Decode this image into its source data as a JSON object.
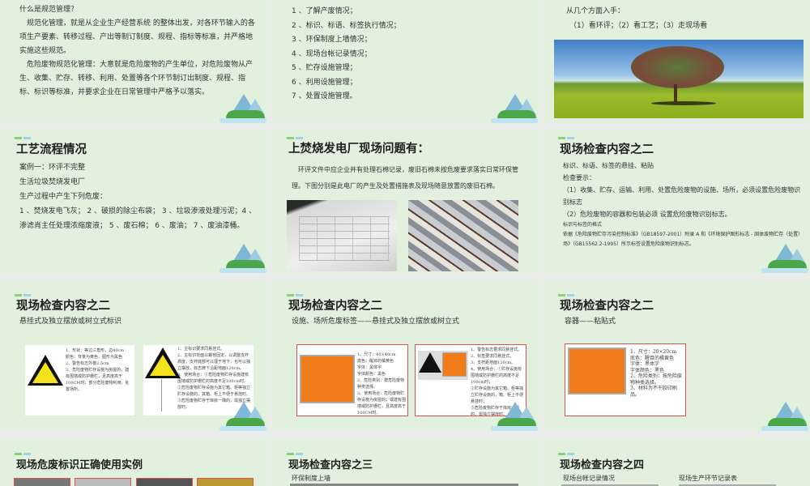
{
  "slides": [
    {
      "lines": [
        "什么是规范管理？",
        "　规范化管理，就是从企业生产经营系统 的整体出发，对各环节输入的各项生产要素、转移过程、产出等制订制度、规程、指标等标准，并严格地实施这些规范。",
        "　危险废物规范化管理：大意就是危险废物的产生单位，对危险废物从产生、收集、贮存、转移、利用、处置等各个环节制订出制度、规程、指标、标识等标准，并要求企业在日常管理中严格予以落实。"
      ]
    },
    {
      "lines": [
        "1 、了解产废情况；",
        "2 、标识、标语、标签执行情况；",
        "3 、环保制度上墙情况；",
        "4 、现场台帐记录情况；",
        "5 、贮存设施管理；",
        "6 、利用设施管理；",
        "7 、处置设施管理。"
      ]
    },
    {
      "lines": [
        "从几个方面入手：",
        "（1）看环评；（2）看工艺；（3）走现场看"
      ]
    },
    {
      "title": "工艺流程情况",
      "lines": [
        "案例一：环评不完整",
        "生活垃圾焚烧发电厂",
        "生产过程中产生下列危废：",
        "1 、焚烧发电飞灰； 2 、破损的除尘布袋； 3 、垃圾渗液处理污泥；4 、渗滤肖主任处理浓缩废液； 5 、废石棉； 6 、废油； 7 、废油漆桶。"
      ]
    },
    {
      "title": "上焚烧发电厂现场问题有：",
      "lines": [
        "　环评文件中应企业并有处理石棉记录，废旧石棉未按危废要求落实日常环保管理。下图分别是此电厂的产生及处置措施表及现场随意放置的废旧石棉。"
      ]
    },
    {
      "title": "现场检查内容之二",
      "lines": [
        "标识、标语、标签的悬挂、粘贴",
        "检查要示：",
        "（1）收集、贮存、运输、利用、处置危险废物的设施、场所，必须设置危险废物识别标志",
        "（2）危险废物的容器和包装必须 设置危险废物识别标志。"
      ],
      "small": [
        "标识与标签的格式",
        "依据《危险废物贮存污染控制标准》（GB18597-2001）附录 A 和《环境保护图形标志 - 固体废物贮存（处置）场》（GB15562.2-1995）所示标签设置危险废物识别标志。"
      ]
    },
    {
      "title": "现场检查内容之二",
      "subtitle": "悬挂式及独立摆放或树立式标识",
      "notes1": [
        "1、形状：等边三角形，边40cm",
        "颜色：背景为黄色，图形为黑色",
        "2、警告标志外檐2.5cm",
        "3、危险废物贮存设施为房屋的，建有围墙或防护栅栏，且高度高于100CM时；部分危险废物利用、处置场所。"
      ],
      "notes2": [
        "1、主标识要求同悬挂式。",
        "2、主标识背面以螺栓固定，以调整支杆高度，支杆底部可以埋于地下，也可以独立摆放，标志牌下沿距地面120cm。",
        "3、使用场合：①危险废物贮存设施建有围墙或防护栅栏的高度不足100cm时。",
        "②危险废物贮存设施为其它箱、柜等独立贮存设施的，其箱、柜上不便于悬挂时。",
        "③危险废物贮存于库房一隅的，需独立摆放时。"
      ]
    },
    {
      "title": "现场检查内容之二",
      "subtitle": "设施、场所危废标签——悬挂式及独立摆放或树立式",
      "notes1": [
        "1、尺寸：40×40cm",
        "底色：醒目的橘黄色",
        "字体：黑体字",
        "字体颜色：黑色",
        "2、危险类别：按危险废物种类选择。",
        "3、使用场合：危险废物贮存设施为房屋的；或建有围墙或防护栅栏，且高度高于100CM时。"
      ],
      "notes2": [
        "1、警告标志要求同悬挂式。",
        "2、标签要求同悬挂式。",
        "3、支杆距地面120cm。",
        "4、使用场合：①贮存设施有围墙或防护栅栏的高度不足100cm时；",
        "②贮存设施为其它箱、柜等独立贮存设施的，箱、柜上不便悬挂时；",
        "③危险废物贮存于库房一隅的，需独立摆放时。"
      ]
    },
    {
      "title": "现场检查内容之二",
      "subtitle": "容器——粘贴式",
      "notes1": [
        "1、尺寸：20×20cm",
        "底色：醒目的橘黄色",
        "字体：黑体字",
        "字体颜色：黑色",
        "2、危险类别：按危险废物种类选择。",
        "3、材料为不干胶印刷品。"
      ]
    },
    {
      "title": "现场危废标识正确使用实例"
    },
    {
      "title": "现场检查内容之三",
      "subtitle": "环保制度上墙"
    },
    {
      "title": "现场检查内容之四",
      "subtitle": "现场台帐记录情况",
      "subtitle2": "现场生产环节记录表"
    }
  ],
  "colors": {
    "slide_bg": "#e2f0de",
    "gap": "#e9ece9",
    "label_orange": "#f07d1a",
    "frame_red": "#d9534f"
  }
}
